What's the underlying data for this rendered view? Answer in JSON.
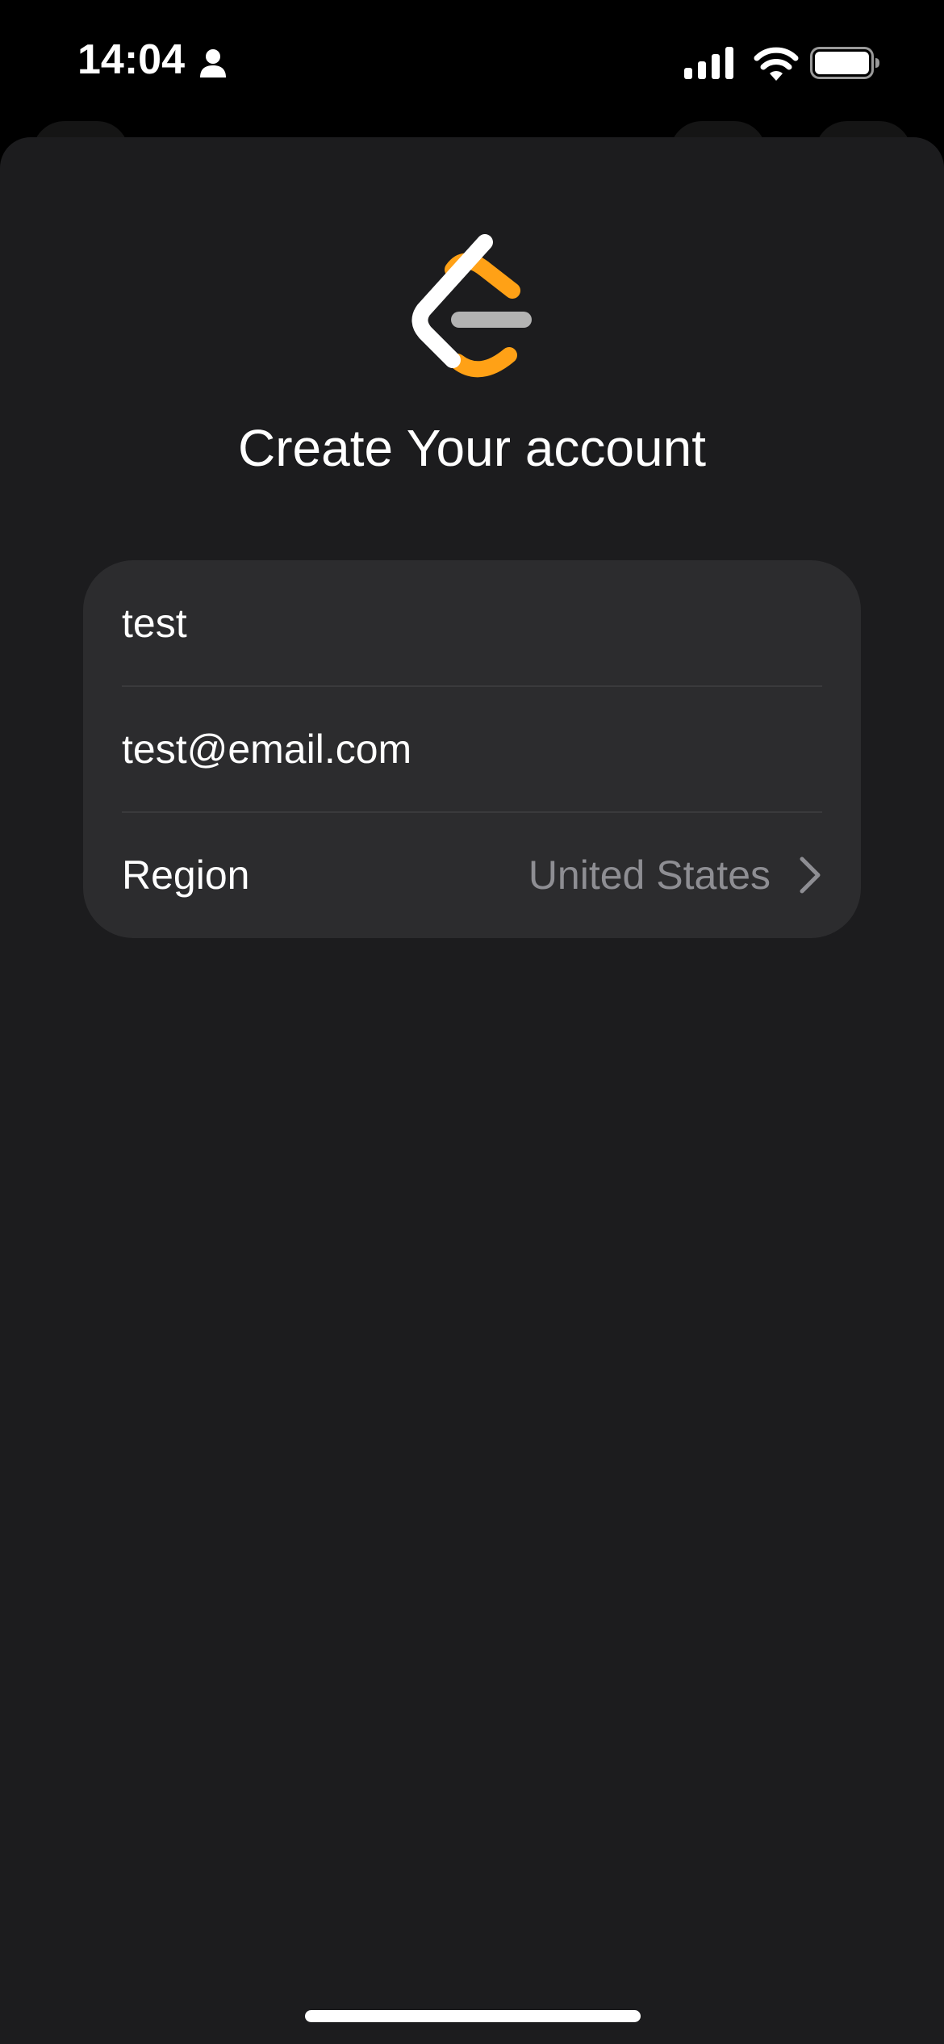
{
  "status_bar": {
    "time": "14:04",
    "icons": [
      "person-icon",
      "cellular-signal-icon",
      "wifi-icon",
      "battery-icon"
    ]
  },
  "sheet": {
    "logo": "leetcode-logo",
    "title": "Create Your account",
    "form": {
      "username_value": "test",
      "email_value": "test@email.com",
      "region_label": "Region",
      "region_value": "United States"
    }
  },
  "colors": {
    "background": "#000000",
    "sheet": "#1c1c1e",
    "card": "#2c2c2e",
    "secondary_text": "#8e8e93",
    "logo_orange": "#FFA116",
    "logo_gray": "#B3B3B3"
  }
}
